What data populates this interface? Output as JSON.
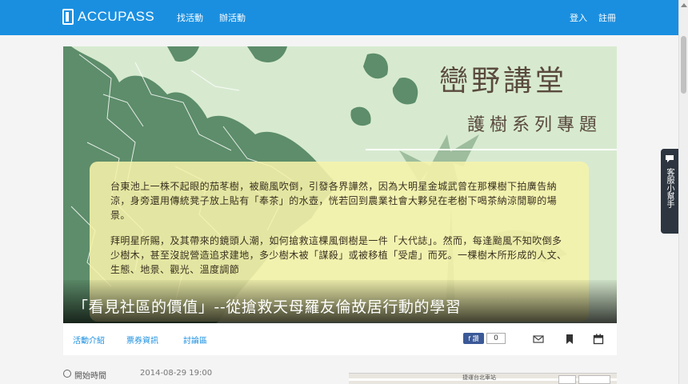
{
  "header": {
    "brand": "ACCUPASS",
    "nav": [
      "找活動",
      "辦活動"
    ],
    "login": "登入",
    "register": "註冊"
  },
  "banner": {
    "title": "巒野講堂",
    "subtitle": "護樹系列專題",
    "paragraphs": [
      "台東池上一株不起眼的茄苳樹，被颱風吹倒，引發各界譁然，因為大明星金城武曾在那棵樹下拍廣告納涼，身旁還用傳統凳子放上貼有「奉茶」的水壺，恍若回到農業社會大夥兒在老樹下喝茶納涼閒聊的場景。",
      "拜明星所賜，及其帶來的鏡頭人潮，如何搶救這棵風倒樹是一件「大代誌」。然而，每逢颱風不知吹倒多少樹木，甚至沒說營造追求建地，多少樹木被「謀殺」或被移植「受虐」而死。一棵樹木所形成的人文、生態、地景、觀光、溫度調節"
    ]
  },
  "event": {
    "title": "「看見社區的價值」--從搶救天母羅友倫故居行動的學習"
  },
  "tabs": [
    "活動介紹",
    "票券資訊",
    "討論區"
  ],
  "share": {
    "fb_label": "f 讚",
    "fb_count": "0"
  },
  "icons": [
    "mail-icon",
    "bookmark-icon",
    "calendar-icon",
    "clock-icon"
  ],
  "info": {
    "start_label": "開始時間",
    "start_value": "2014-08-29 19:00",
    "map_label": "捷運台北車站"
  },
  "side_widget": {
    "label": "客服小幫手"
  },
  "colors": {
    "brand_blue": "#1a8fe0",
    "banner_green": "#d7ead0",
    "map_green": "#5d8d6a",
    "textbox_yellow": "#f6f3aa",
    "title_brown": "#5a4a3e"
  }
}
